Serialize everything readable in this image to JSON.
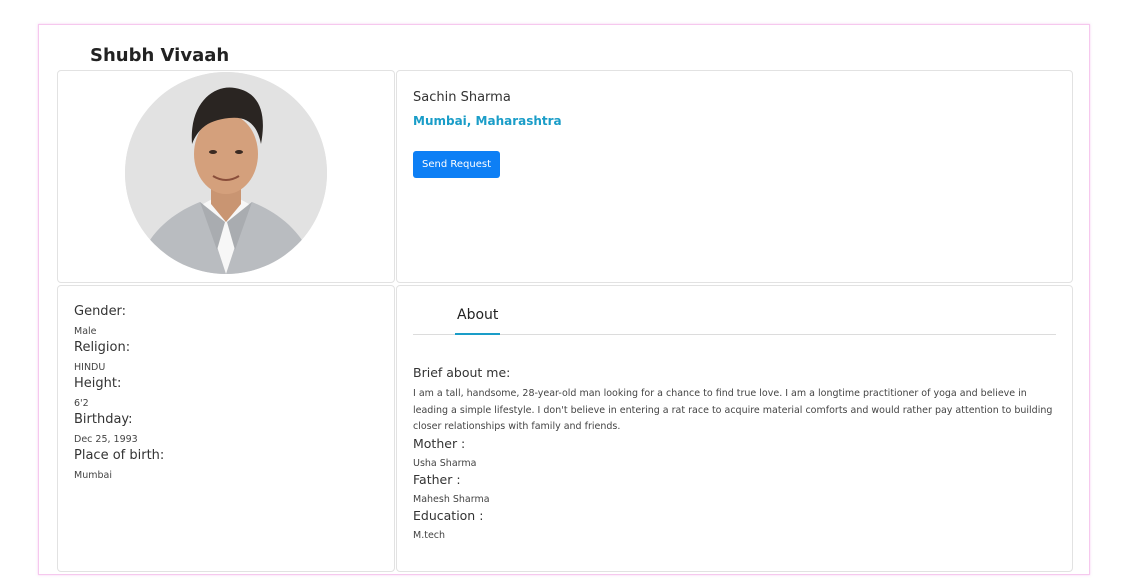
{
  "brand": "Shubh Vivaah",
  "profile": {
    "name": "Sachin Sharma",
    "location": "Mumbai, Maharashtra",
    "send_request_label": "Send Request"
  },
  "details": [
    {
      "label": "Gender:",
      "value": "Male"
    },
    {
      "label": "Religion:",
      "value": "HINDU"
    },
    {
      "label": "Height:",
      "value": "6'2"
    },
    {
      "label": "Birthday:",
      "value": "Dec 25, 1993"
    },
    {
      "label": "Place of birth:",
      "value": "Mumbai"
    }
  ],
  "tabs": {
    "active": "About"
  },
  "about": {
    "brief_label": "Brief about me:",
    "brief_text": "I am a tall, handsome, 28-year-old man looking for a chance to find true love. I am a longtime practitioner of yoga and believe in leading a simple lifestyle. I don't believe in entering a rat race to acquire material comforts and would rather pay attention to building closer relationships with family and friends.",
    "mother_label": "Mother :",
    "mother_value": "Usha Sharma",
    "father_label": "Father :",
    "father_value": "Mahesh Sharma",
    "education_label": "Education :",
    "education_value": "M.tech"
  },
  "colors": {
    "accent": "#1a9dc8",
    "button": "#0d7ff5",
    "frame_border": "#f6c8ee"
  }
}
